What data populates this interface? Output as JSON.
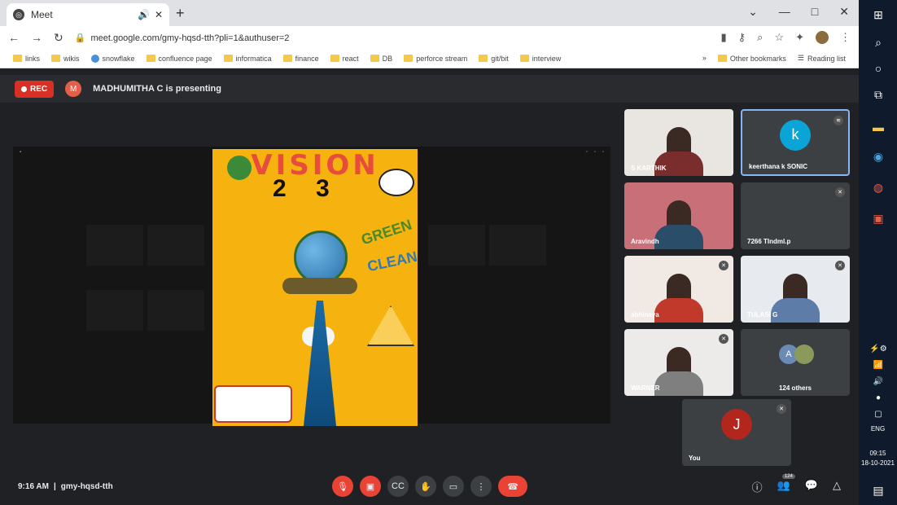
{
  "tab": {
    "title": "Meet",
    "favicon": "meet-icon"
  },
  "window_controls": [
    "⌄",
    "—",
    "□",
    "✕"
  ],
  "address": {
    "url": "meet.google.com/gmy-hqsd-tth?pli=1&authuser=2"
  },
  "bookmarks": [
    {
      "label": "links",
      "icon": "folder-icon"
    },
    {
      "label": "wikis",
      "icon": "folder-icon"
    },
    {
      "label": "snowflake",
      "icon": "globe-icon"
    },
    {
      "label": "confluence page",
      "icon": "folder-icon"
    },
    {
      "label": "informatica",
      "icon": "folder-icon"
    },
    {
      "label": "finance",
      "icon": "folder-icon"
    },
    {
      "label": "react",
      "icon": "folder-icon"
    },
    {
      "label": "DB",
      "icon": "folder-icon"
    },
    {
      "label": "perforce stream",
      "icon": "folder-icon"
    },
    {
      "label": "git/bit",
      "icon": "folder-icon"
    },
    {
      "label": "interview",
      "icon": "folder-icon"
    }
  ],
  "bookmarks_right": {
    "other": "Other bookmarks",
    "reading": "Reading list"
  },
  "meet": {
    "rec_label": "REC",
    "presenter_initial": "M",
    "presenting_text": "MADHUMITHA C is presenting",
    "poster": {
      "title": "VISION",
      "year": "2 3",
      "green": "GREEN",
      "clean": "CLEAN"
    }
  },
  "participants": [
    {
      "name": "S KARTHIK",
      "type": "video",
      "bg": "#e9e6e2"
    },
    {
      "name": "keerthana k SONIC",
      "type": "avatar",
      "initial": "k",
      "avatar_color": "#0aa5d6",
      "highlight": true
    },
    {
      "name": "Aravindh",
      "type": "video",
      "bg": "#c96f78"
    },
    {
      "name": "7266 TIndml.p",
      "type": "empty"
    },
    {
      "name": "abhinaya",
      "type": "video",
      "bg": "#f1e9e4"
    },
    {
      "name": "TULASI G",
      "type": "video",
      "bg": "#e7eaee"
    },
    {
      "name": "WARNER",
      "type": "video",
      "bg": "#ecebea"
    },
    {
      "name": "124 others",
      "type": "others",
      "initial": "A"
    },
    {
      "name": "You",
      "type": "avatar",
      "initial": "J",
      "avatar_color": "#b3261e"
    }
  ],
  "bottom": {
    "time": "9:16 AM",
    "separator": "|",
    "code": "gmy-hqsd-tth",
    "others_badge": "124"
  },
  "taskbar": {
    "lang": "ENG",
    "time": "09:15",
    "date": "18-10-2021"
  }
}
